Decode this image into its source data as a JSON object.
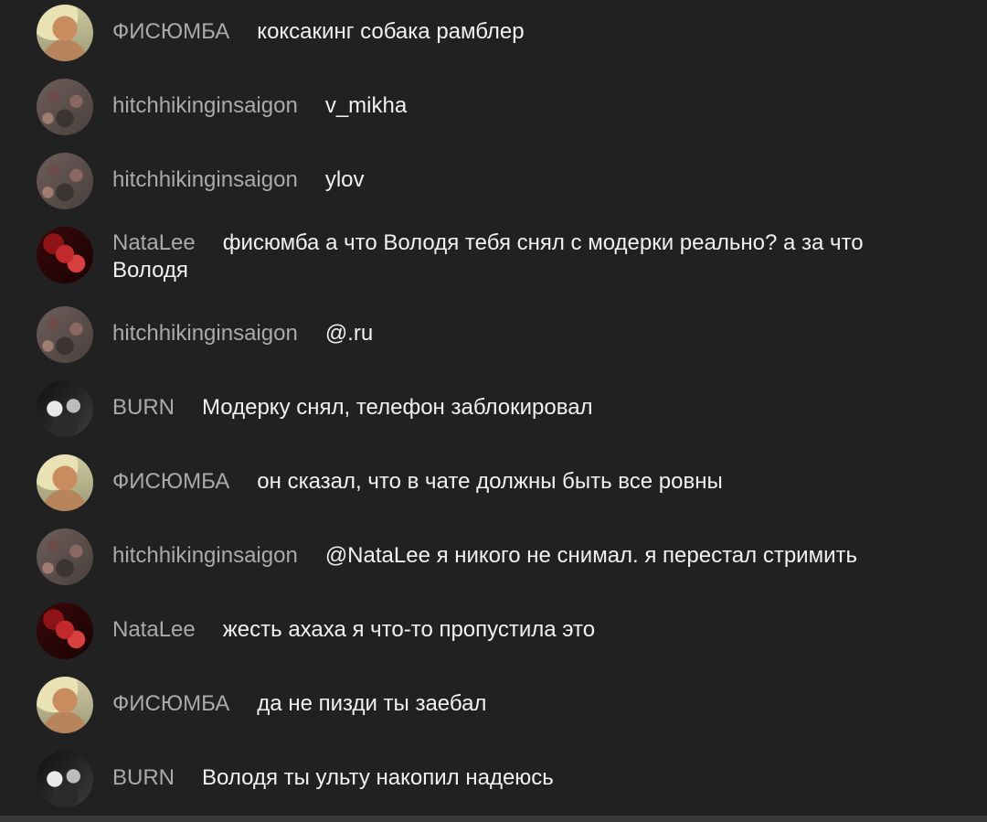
{
  "messages": [
    {
      "author": "ФИСЮМБА",
      "text": "коксакинг собака рамблер",
      "avatar_icon": "profile-photo-man-smiling"
    },
    {
      "author": "hitchhikinginsaigon",
      "text": "v_mikha",
      "avatar_icon": "profile-photo-dark-textured"
    },
    {
      "author": "hitchhikinginsaigon",
      "text": "ylov",
      "avatar_icon": "profile-photo-dark-textured"
    },
    {
      "author": "NataLee",
      "text": "фисюмба а что Володя тебя снял с модерки реально? а за что Володя",
      "avatar_icon": "profile-photo-red-character"
    },
    {
      "author": "hitchhikinginsaigon",
      "text": "@.ru",
      "avatar_icon": "profile-photo-dark-textured"
    },
    {
      "author": "BURN",
      "text": "Модерку снял, телефон заблокировал",
      "avatar_icon": "profile-photo-black-white"
    },
    {
      "author": "ФИСЮМБА",
      "text": "он сказал, что в чате должны быть все ровны",
      "avatar_icon": "profile-photo-man-smiling"
    },
    {
      "author": "hitchhikinginsaigon",
      "text": "@NataLee я никого не снимал. я перестал стримить",
      "avatar_icon": "profile-photo-dark-textured"
    },
    {
      "author": "NataLee",
      "text": "жесть ахаха я что-то пропустила это",
      "avatar_icon": "profile-photo-red-character"
    },
    {
      "author": "ФИСЮМБА",
      "text": "да не пизди ты заебал",
      "avatar_icon": "profile-photo-man-smiling"
    },
    {
      "author": "BURN",
      "text": "Володя ты ульту накопил надеюсь",
      "avatar_icon": "profile-photo-black-white"
    }
  ]
}
